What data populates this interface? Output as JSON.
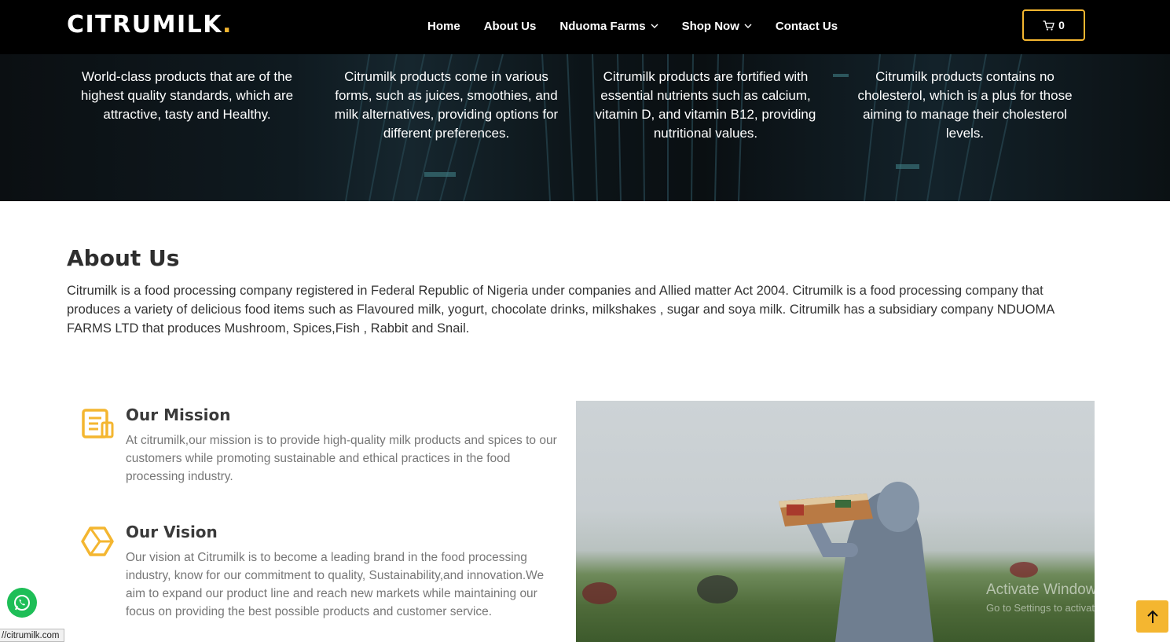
{
  "header": {
    "logo": "CITRUMILK",
    "logo_dot": ".",
    "nav": [
      {
        "label": "Home",
        "dropdown": false
      },
      {
        "label": "About Us",
        "dropdown": false
      },
      {
        "label": "Nduoma Farms",
        "dropdown": true
      },
      {
        "label": "Shop Now",
        "dropdown": true
      },
      {
        "label": "Contact Us",
        "dropdown": false
      }
    ],
    "cart_count": "0",
    "cart_icon": "cart-icon"
  },
  "hero": {
    "features": [
      "World-class products that are of the highest quality standards, which are attractive, tasty and Healthy.",
      "Citrumilk products come in various forms, such as juices, smoothies, and milk alternatives, providing options for different preferences.",
      "Citrumilk products are fortified with essential nutrients such as calcium, vitamin D, and vitamin B12, providing nutritional values.",
      "Citrumilk products contains no cholesterol, which is a plus for those aiming to manage their cholesterol levels."
    ]
  },
  "about": {
    "title": "About Us",
    "text": "Citrumilk is a food processing company registered in Federal Republic of Nigeria under companies and Allied matter Act 2004. Citrumilk is a food processing company that produces a variety of delicious food items such as Flavoured milk, yogurt, chocolate drinks, milkshakes , sugar and soya milk. Citrumilk has a subsidiary company NDUOMA FARMS LTD that produces Mushroom, Spices,Fish , Rabbit and Snail."
  },
  "mission": {
    "icon": "document-icon",
    "title": "Our Mission",
    "text": "At citrumilk,our mission is to provide high-quality milk products and spices to our customers while promoting sustainable and ethical practices in the food processing industry."
  },
  "vision": {
    "icon": "cube-icon",
    "title": "Our Vision",
    "text": "Our vision at Citrumilk is to become a leading brand in the food processing industry, know for our commitment to quality, Sustainability,and innovation.We aim to expand our product line and reach new markets while maintaining our focus on providing the best possible products and customer service."
  },
  "overlays": {
    "status_url": "//citrumilk.com",
    "activate_title": "Activate Windows",
    "activate_sub": "Go to Settings to activate Windows.",
    "whatsapp_icon": "whatsapp-icon",
    "back_to_top_icon": "arrow-up-icon"
  },
  "colors": {
    "accent": "#f4b630",
    "header_bg": "#000000",
    "whatsapp": "#1ebe57"
  }
}
